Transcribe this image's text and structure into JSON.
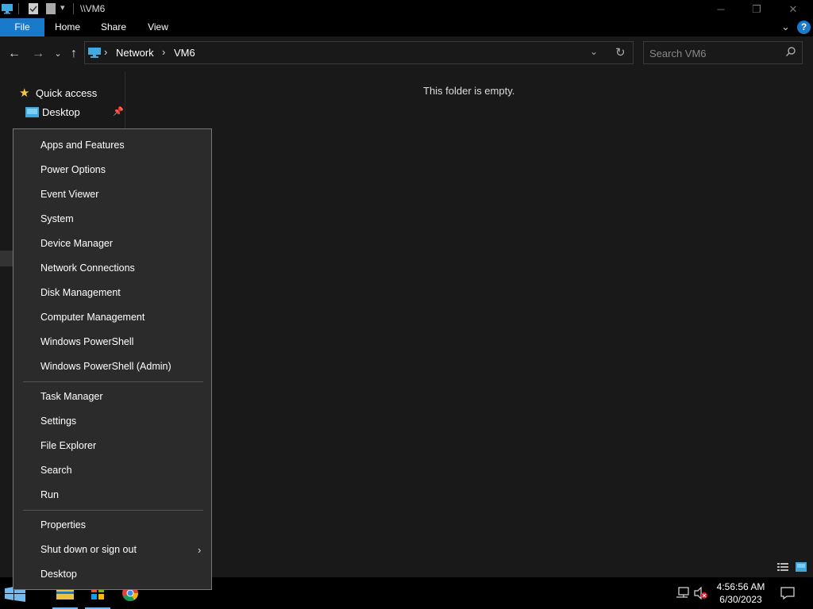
{
  "window": {
    "title": "\\\\VM6",
    "minimize": "─",
    "restore": "❐",
    "close": "✕"
  },
  "ribbon": {
    "tabs": [
      "File",
      "Home",
      "Share",
      "View"
    ],
    "help": "?"
  },
  "address": {
    "crumbs": [
      "Network",
      "VM6"
    ]
  },
  "search": {
    "placeholder": "Search VM6"
  },
  "nav_pane": {
    "items": [
      {
        "label": "Quick access",
        "icon": "star-icon"
      },
      {
        "label": "Desktop",
        "icon": "desktop-folder-icon",
        "pinned": true
      }
    ]
  },
  "content": {
    "empty_message": "This folder is empty."
  },
  "context_menu": {
    "groups": [
      [
        "Apps and Features",
        "Power Options",
        "Event Viewer",
        "System",
        "Device Manager",
        "Network Connections",
        "Disk Management",
        "Computer Management",
        "Windows PowerShell",
        "Windows PowerShell (Admin)"
      ],
      [
        "Task Manager",
        "Settings",
        "File Explorer",
        "Search",
        "Run"
      ],
      [
        "Properties",
        "Shut down or sign out",
        "Desktop"
      ]
    ],
    "submenu_item": "Shut down or sign out"
  },
  "taskbar": {
    "apps": [
      "start-icon",
      "file-explorer-icon",
      "store-icon",
      "chrome-icon"
    ],
    "time": "4:56:56 AM",
    "date": "6/30/2023"
  },
  "colors": {
    "accent": "#1979ca",
    "menu_bg": "#2b2b2b",
    "window_bg": "#191919"
  }
}
